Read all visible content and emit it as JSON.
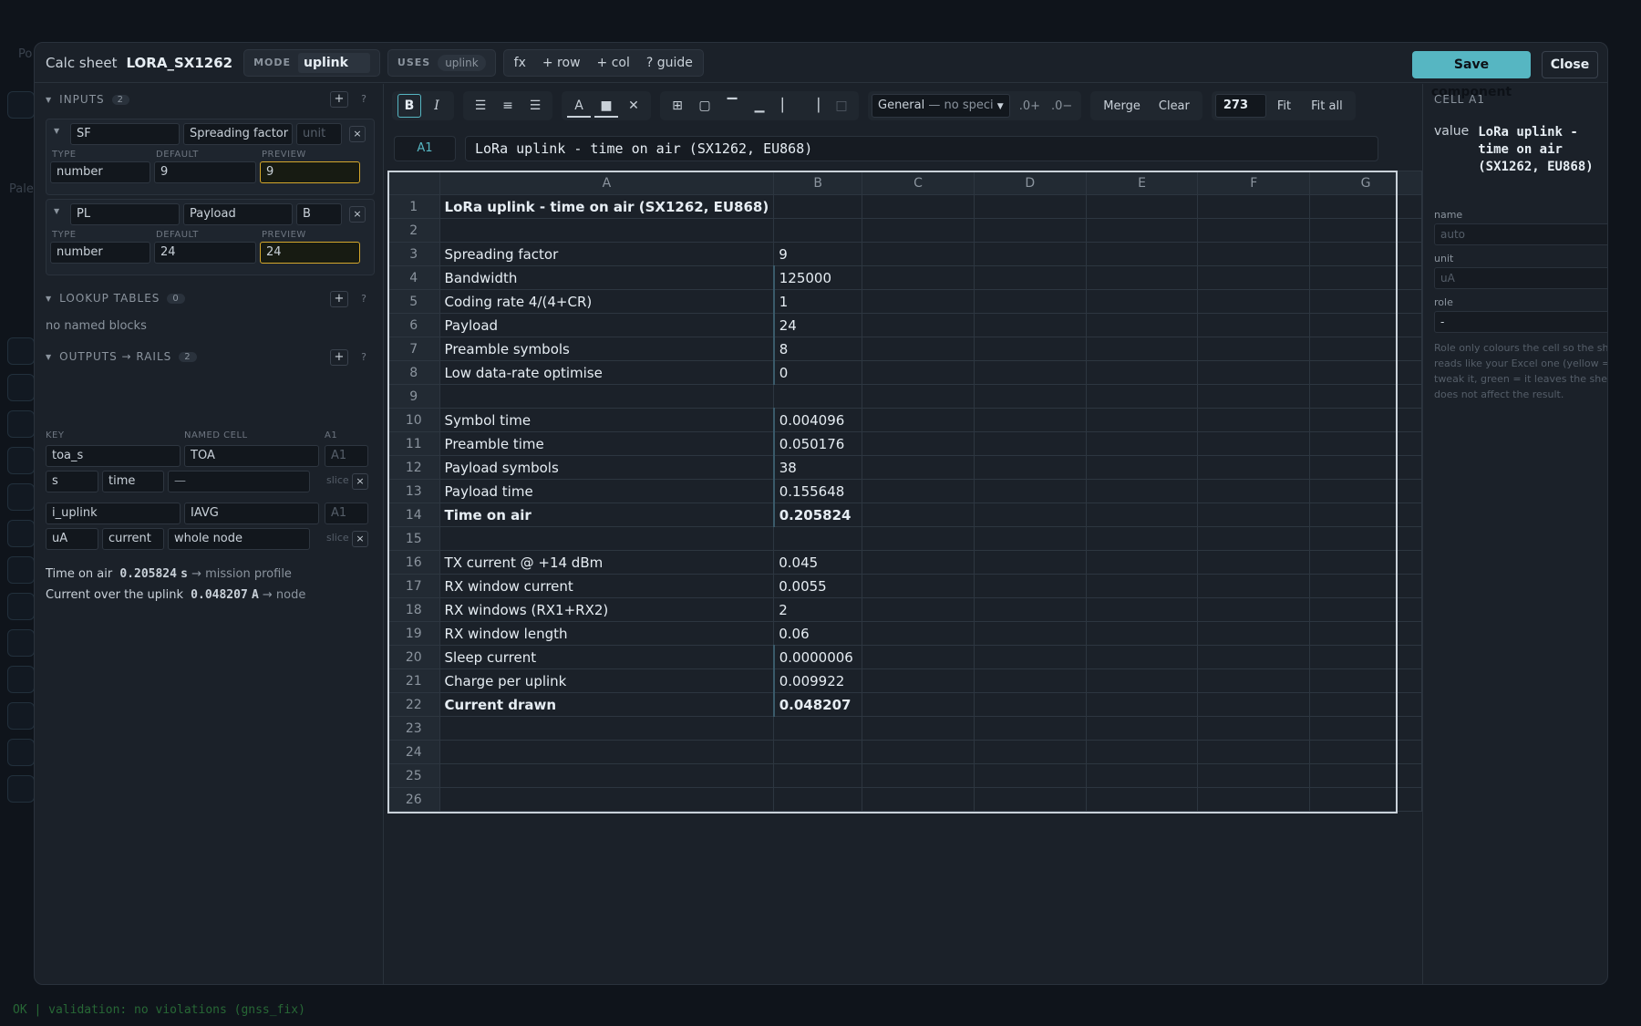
{
  "modal": {
    "title_label": "Calc sheet",
    "sheet_name": "LORA_SX1262",
    "mode_label": "MODE",
    "mode_value": "uplink",
    "uses_label": "USES",
    "uses_value": "uplink",
    "btn_fx": "fx",
    "btn_row": "+ row",
    "btn_col": "+ col",
    "btn_guide": "? guide",
    "ok_label": "OK",
    "save_label": "Save component",
    "close_label": "Close"
  },
  "inputs": {
    "header": "INPUTS",
    "count": "2",
    "add": "+",
    "help": "?",
    "type_label": "TYPE",
    "default_label": "DEFAULT",
    "preview_label": "PREVIEW",
    "items": [
      {
        "key": "SF",
        "label": "Spreading factor",
        "unit": "unit",
        "type": "number",
        "default": "9",
        "preview": "9"
      },
      {
        "key": "PL",
        "label": "Payload",
        "unit": "B",
        "type": "number",
        "default": "24",
        "preview": "24"
      }
    ]
  },
  "lookup": {
    "header": "LOOKUP TABLES",
    "count": "0",
    "add": "+",
    "help": "?",
    "empty": "no named blocks"
  },
  "outputs": {
    "header": "OUTPUTS → RAILS",
    "count": "2",
    "add": "+",
    "help": "?",
    "key_label": "KEY",
    "named_label": "NAMED CELL",
    "a1_label": "A1",
    "items": [
      {
        "key": "toa_s",
        "named": "TOA",
        "a1": "A1",
        "unit": "s",
        "quantity": "time",
        "scope": "—",
        "slice": "slice"
      },
      {
        "key": "i_uplink",
        "named": "IAVG",
        "a1": "A1",
        "unit": "uA",
        "quantity": "current",
        "scope": "whole node",
        "slice": "slice"
      }
    ],
    "summary": [
      {
        "label": "Time on air",
        "value": "0.205824",
        "unit": "s",
        "target": "→ mission profile"
      },
      {
        "label": "Current over the uplink",
        "value": "0.048207",
        "unit": "A",
        "target": "→ node"
      }
    ]
  },
  "toolbar": {
    "bold": "B",
    "italic": "I",
    "format": "General",
    "format_sub": "— no speci",
    "inc_dec": ".0+",
    "dec_dec": ".0−",
    "merge": "Merge",
    "clear": "Clear",
    "width": "273",
    "fit": "Fit",
    "fit_all": "Fit all"
  },
  "formula": {
    "ref": "A1",
    "text": "LoRa uplink - time on air (SX1262, EU868)"
  },
  "sheet": {
    "columns": [
      "A",
      "B",
      "C",
      "D",
      "E",
      "F",
      "G"
    ],
    "rows": [
      {
        "n": "1",
        "a": "LoRa uplink - time on air (SX1262, EU868)",
        "b": ""
      },
      {
        "n": "2",
        "a": "",
        "b": ""
      },
      {
        "n": "3",
        "a": "Spreading factor",
        "b": "9"
      },
      {
        "n": "4",
        "a": "Bandwidth",
        "b": "125000"
      },
      {
        "n": "5",
        "a": "Coding rate 4/(4+CR)",
        "b": "1"
      },
      {
        "n": "6",
        "a": "Payload",
        "b": "24"
      },
      {
        "n": "7",
        "a": "Preamble symbols",
        "b": "8"
      },
      {
        "n": "8",
        "a": "Low data-rate optimise",
        "b": "0"
      },
      {
        "n": "9",
        "a": "",
        "b": ""
      },
      {
        "n": "10",
        "a": "Symbol time",
        "b": "0.004096"
      },
      {
        "n": "11",
        "a": "Preamble time",
        "b": "0.050176"
      },
      {
        "n": "12",
        "a": "Payload symbols",
        "b": "38"
      },
      {
        "n": "13",
        "a": "Payload time",
        "b": "0.155648"
      },
      {
        "n": "14",
        "a": "Time on air",
        "b": "0.205824"
      },
      {
        "n": "15",
        "a": "",
        "b": ""
      },
      {
        "n": "16",
        "a": "TX current @ +14 dBm",
        "b": "0.045"
      },
      {
        "n": "17",
        "a": "RX window current",
        "b": "0.0055"
      },
      {
        "n": "18",
        "a": "RX windows (RX1+RX2)",
        "b": "2"
      },
      {
        "n": "19",
        "a": "RX window length",
        "b": "0.06"
      },
      {
        "n": "20",
        "a": "Sleep current",
        "b": "0.0000006"
      },
      {
        "n": "21",
        "a": "Charge per uplink",
        "b": "0.009922"
      },
      {
        "n": "22",
        "a": "Current drawn",
        "b": "0.048207"
      },
      {
        "n": "23",
        "a": "",
        "b": ""
      },
      {
        "n": "24",
        "a": "",
        "b": ""
      },
      {
        "n": "25",
        "a": "",
        "b": ""
      },
      {
        "n": "26",
        "a": "",
        "b": ""
      }
    ]
  },
  "cell_panel": {
    "header": "CELL A1",
    "value_label": "value",
    "value": "LoRa uplink - time on air (SX1262, EU868)",
    "name_label": "name",
    "name_ph": "auto",
    "unit_label": "unit",
    "unit_ph": "uA",
    "role_label": "role",
    "role_value": "-",
    "help": "Role only colours the cell so the sheet reads like your Excel one (yellow = you tweak it, green = it leaves the sheet). It does not affect the result."
  },
  "status": "OK | validation: no violations (gnss_fix)"
}
